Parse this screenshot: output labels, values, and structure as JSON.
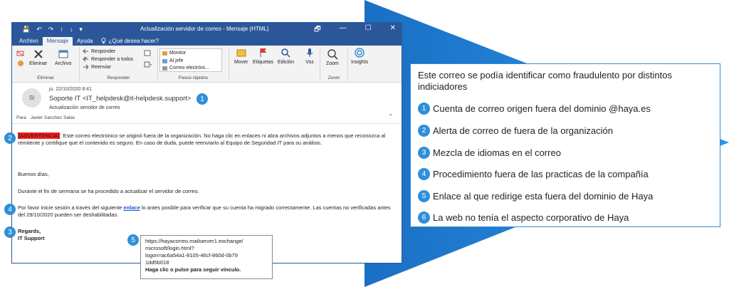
{
  "window": {
    "title": "Actualización servidor de correo  -  Mensaje (HTML)",
    "qat": [
      "💾",
      "↶",
      "↷",
      "↑",
      "↓",
      "▾"
    ],
    "controls": [
      "🗗",
      "—",
      "☐",
      "✕"
    ]
  },
  "tabs": [
    {
      "label": "Archivo"
    },
    {
      "label": "Mensaje"
    },
    {
      "label": "Ayuda"
    },
    {
      "label": "¿Qué desea hacer?"
    }
  ],
  "ribbon": {
    "eliminar": {
      "delete_label": "Eliminar",
      "archive_label": "Archivo",
      "group": "Eliminar"
    },
    "responder": {
      "reply": "Responder",
      "reply_all": "Responder a todos",
      "forward": "Reenviar",
      "group": "Responder"
    },
    "pasos": {
      "items": [
        "Monitor",
        "Al jefe",
        "Correo electróni..."
      ],
      "group": "Pasos rápidos"
    },
    "mover": {
      "label": "Mover"
    },
    "etiquetas": {
      "label": "Etiquetas"
    },
    "edicion": {
      "label": "Edición"
    },
    "voz": {
      "label": "Voz"
    },
    "zoom": {
      "label": "Zoom",
      "group": "Zoom"
    },
    "insights": {
      "label": "Insights"
    }
  },
  "message": {
    "avatar": "SI",
    "date": "ju. 22/10/2020 8:41",
    "sender": "Soporte IT <IT_helpdesk@it-helpdesk.support>",
    "subject": "Actualización servidor de correo",
    "to_label": "Para",
    "to_value": "Javier Sanchez Salas",
    "warning_tag": "[ADVERTENCIA]",
    "warning_text": ": Este correo electrónico se originó fuera de la organización. No haga clic en enlaces ni abra archivos adjuntos a menos que reconozca al remitente y certifique que el contenido es seguro. En caso de duda, puede reenviarlo al Equipo de Seguridad IT para su análisis.",
    "greeting": "Buenos días,",
    "para1": "Durante el fin de sermana se ha procedido a actualizar el servidor de correo.",
    "para2_before": "Por favor inicie sesión a través del siguiente ",
    "para2_link": "enlace",
    "para2_after": " lo antes posible para verificar que su cuenta ha migrado correctamente. Las cuentas no verificadas antes del 29/10/2020 pueden ser deshabilitadas.",
    "regards": "Regards,",
    "signature": "IT Support"
  },
  "tooltip": {
    "line1": "https://hayacorreo.mailserver1.exchange/",
    "line2": "microsoft/login.html?",
    "line3": "logon=ac6a54a1-8105-46cf-860d-0b79",
    "line4": "1dd5b018",
    "hint": "Haga clic o pulse para seguir vínculo."
  },
  "badges": [
    "1",
    "2",
    "3",
    "4",
    "5",
    "6"
  ],
  "panel": {
    "title": "Este correo se podía identificar como fraudulento por distintos indiciadores",
    "items": [
      {
        "num": "1",
        "text": "Cuenta de correo origen fuera del dominio @haya.es"
      },
      {
        "num": "2",
        "text": "Alerta de correo de fuera de la organización"
      },
      {
        "num": "3",
        "text": "Mezcla de idiomas en el correo"
      },
      {
        "num": "4",
        "text": "Procedimiento fuera de las practicas de la compañía"
      },
      {
        "num": "5",
        "text": "Enlace al que redirige esta fuera del dominio de Haya"
      },
      {
        "num": "6",
        "text": "La web no tenía el aspecto corporativo de Haya"
      }
    ]
  },
  "colors": {
    "accent": "#2b579a",
    "badge": "#2f8fd8",
    "arrow": "#1e7ed6",
    "warning": "#ff2020"
  }
}
